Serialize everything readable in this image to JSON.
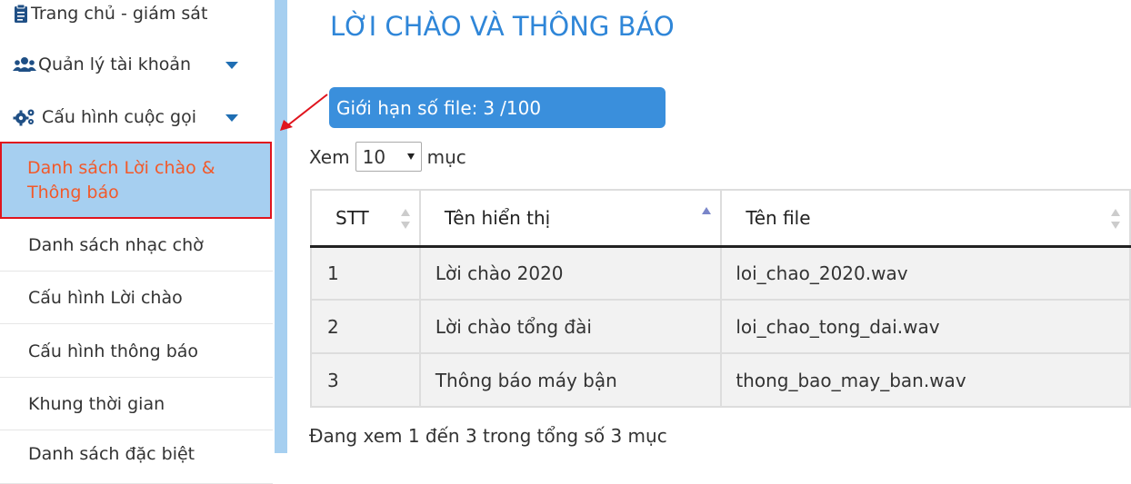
{
  "sidebar": {
    "items": [
      {
        "label": "Trang chủ - giám sát",
        "icon": "clipboard-icon"
      },
      {
        "label": "Quản lý tài khoản",
        "icon": "users-icon"
      },
      {
        "label": "Cấu hình cuộc gọi",
        "icon": "gears-icon"
      }
    ],
    "submenu": [
      {
        "label": "Danh sách Lời chào & Thông báo",
        "active": true
      },
      {
        "label": "Danh sách nhạc chờ"
      },
      {
        "label": "Cấu hình Lời chào"
      },
      {
        "label": "Cấu hình thông báo"
      },
      {
        "label": "Khung thời gian"
      },
      {
        "label": "Danh sách đặc biệt"
      }
    ]
  },
  "main": {
    "title": "LỜI CHÀO VÀ THÔNG BÁO",
    "limit": {
      "label": "Giới hạn số file:",
      "current": "3",
      "max": "/100"
    },
    "length": {
      "prefix": "Xem",
      "value": "10",
      "suffix": "mục"
    },
    "table": {
      "columns": [
        "STT",
        "Tên hiển thị",
        "Tên file"
      ],
      "rows": [
        [
          "1",
          "Lời chào 2020",
          "loi_chao_2020.wav"
        ],
        [
          "2",
          "Lời chào tổng đài",
          "loi_chao_tong_dai.wav"
        ],
        [
          "3",
          "Thông báo máy bận",
          "thong_bao_may_ban.wav"
        ]
      ]
    },
    "info": "Đang xem 1 đến 3 trong tổng số 3 mục"
  },
  "colors": {
    "accent": "#2f86d8",
    "highlight": "#a6cff0",
    "active_text": "#f2592a",
    "annotation": "#e0141d"
  }
}
